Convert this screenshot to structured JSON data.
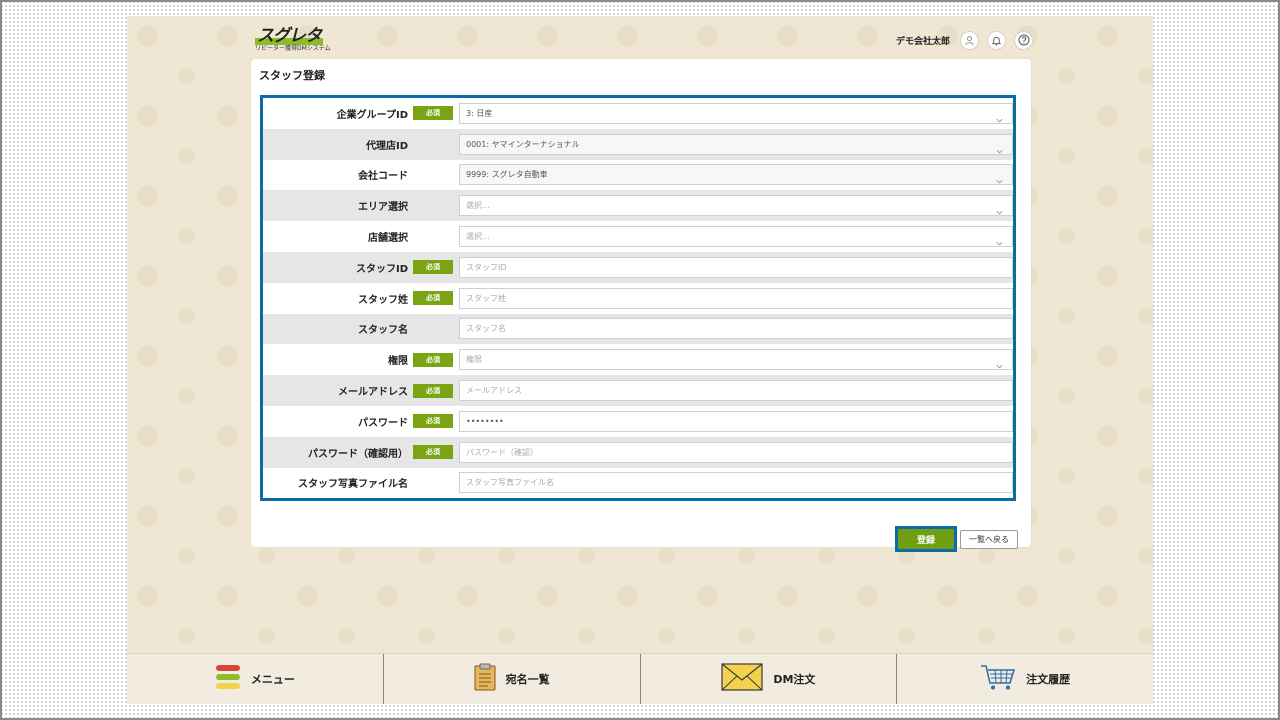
{
  "header": {
    "logo_main": "スグレタ",
    "logo_sub": "リピーター獲得DMシステム",
    "user_name": "デモ会社太郎",
    "icons": [
      "user-icon",
      "bell-icon",
      "help-icon"
    ]
  },
  "page": {
    "title": "スタッフ登録"
  },
  "form": {
    "required_badge": "必須",
    "fields": [
      {
        "label": "企業グループID",
        "required": true,
        "type": "select",
        "value": "3: 日産",
        "placeholder": ""
      },
      {
        "label": "代理店ID",
        "required": false,
        "type": "select",
        "value": "0001: ヤマインターナショナル",
        "placeholder": ""
      },
      {
        "label": "会社コード",
        "required": false,
        "type": "select",
        "value": "9999: スグレタ自動車",
        "placeholder": ""
      },
      {
        "label": "エリア選択",
        "required": false,
        "type": "select",
        "value": "",
        "placeholder": "選択..."
      },
      {
        "label": "店舗選択",
        "required": false,
        "type": "select",
        "value": "",
        "placeholder": "選択..."
      },
      {
        "label": "スタッフID",
        "required": true,
        "type": "text",
        "value": "",
        "placeholder": "スタッフID"
      },
      {
        "label": "スタッフ姓",
        "required": true,
        "type": "text",
        "value": "",
        "placeholder": "スタッフ姓"
      },
      {
        "label": "スタッフ名",
        "required": false,
        "type": "text",
        "value": "",
        "placeholder": "スタッフ名"
      },
      {
        "label": "権限",
        "required": true,
        "type": "select",
        "value": "",
        "placeholder": "権限"
      },
      {
        "label": "メールアドレス",
        "required": true,
        "type": "text",
        "value": "",
        "placeholder": "メールアドレス"
      },
      {
        "label": "パスワード",
        "required": true,
        "type": "password",
        "value": "••••••••",
        "placeholder": ""
      },
      {
        "label": "パスワード（確認用）",
        "required": true,
        "type": "text",
        "value": "",
        "placeholder": "パスワード（確認）"
      },
      {
        "label": "スタッフ写真ファイル名",
        "required": false,
        "type": "text",
        "value": "",
        "placeholder": "スタッフ写真ファイル名"
      }
    ],
    "submit_label": "登録",
    "back_label": "一覧へ戻る"
  },
  "bottom_nav": {
    "items": [
      {
        "label": "メニュー",
        "icon": "menu-icon"
      },
      {
        "label": "宛名一覧",
        "icon": "clipboard-icon"
      },
      {
        "label": "DM注文",
        "icon": "envelope-icon"
      },
      {
        "label": "注文履歴",
        "icon": "cart-icon"
      }
    ]
  },
  "colors": {
    "accent_green": "#7aa414",
    "highlight_blue": "#0b6aa8",
    "background_beige": "#efe6d3"
  }
}
